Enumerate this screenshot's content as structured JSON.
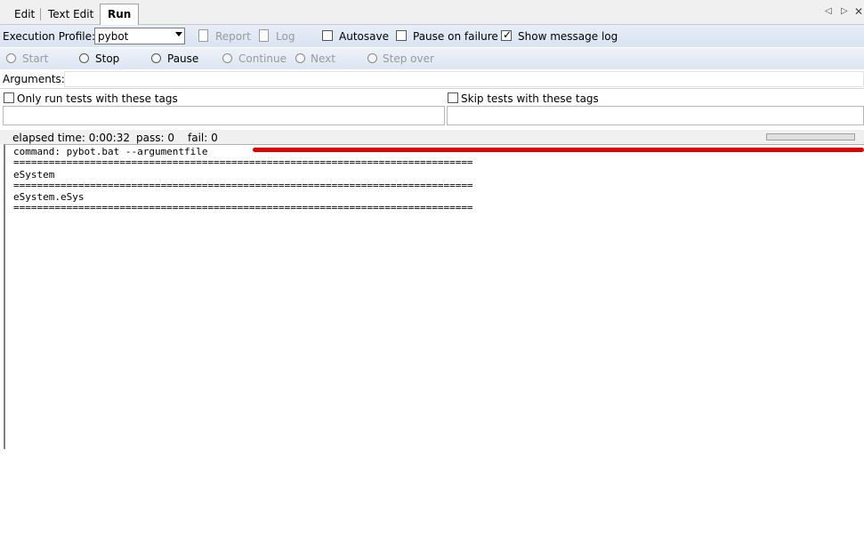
{
  "tabs": [
    {
      "label": "Edit",
      "active": false
    },
    {
      "label": "Text Edit",
      "active": false
    },
    {
      "label": "Run",
      "active": true
    }
  ],
  "profile": {
    "label": "Execution Profile:",
    "selected": "pybot",
    "report_label": "Report",
    "log_label": "Log",
    "autosave_label": "Autosave",
    "autosave_checked": false,
    "pause_label": "Pause on failure",
    "pause_checked": false,
    "show_log_label": "Show message log",
    "show_log_checked": true
  },
  "controls": {
    "start": "Start",
    "stop": "Stop",
    "pause": "Pause",
    "continue": "Continue",
    "next": "Next",
    "step_over": "Step over"
  },
  "arguments": {
    "label": "Arguments:",
    "value": ""
  },
  "tags": {
    "only_run_label": "Only run tests with these tags",
    "skip_label": "Skip tests with these tags"
  },
  "status": {
    "elapsed": "elapsed time: 0:00:32",
    "pass": "pass: 0",
    "fail": "fail: 0"
  },
  "output": {
    "command": "command: pybot.bat --argumentfile",
    "separator": "==============================================================================",
    "lines": [
      "eSystem",
      "eSystem.eSys"
    ]
  },
  "colors": {
    "redaction": "#e00000",
    "toolbar": "#dde5f3"
  }
}
